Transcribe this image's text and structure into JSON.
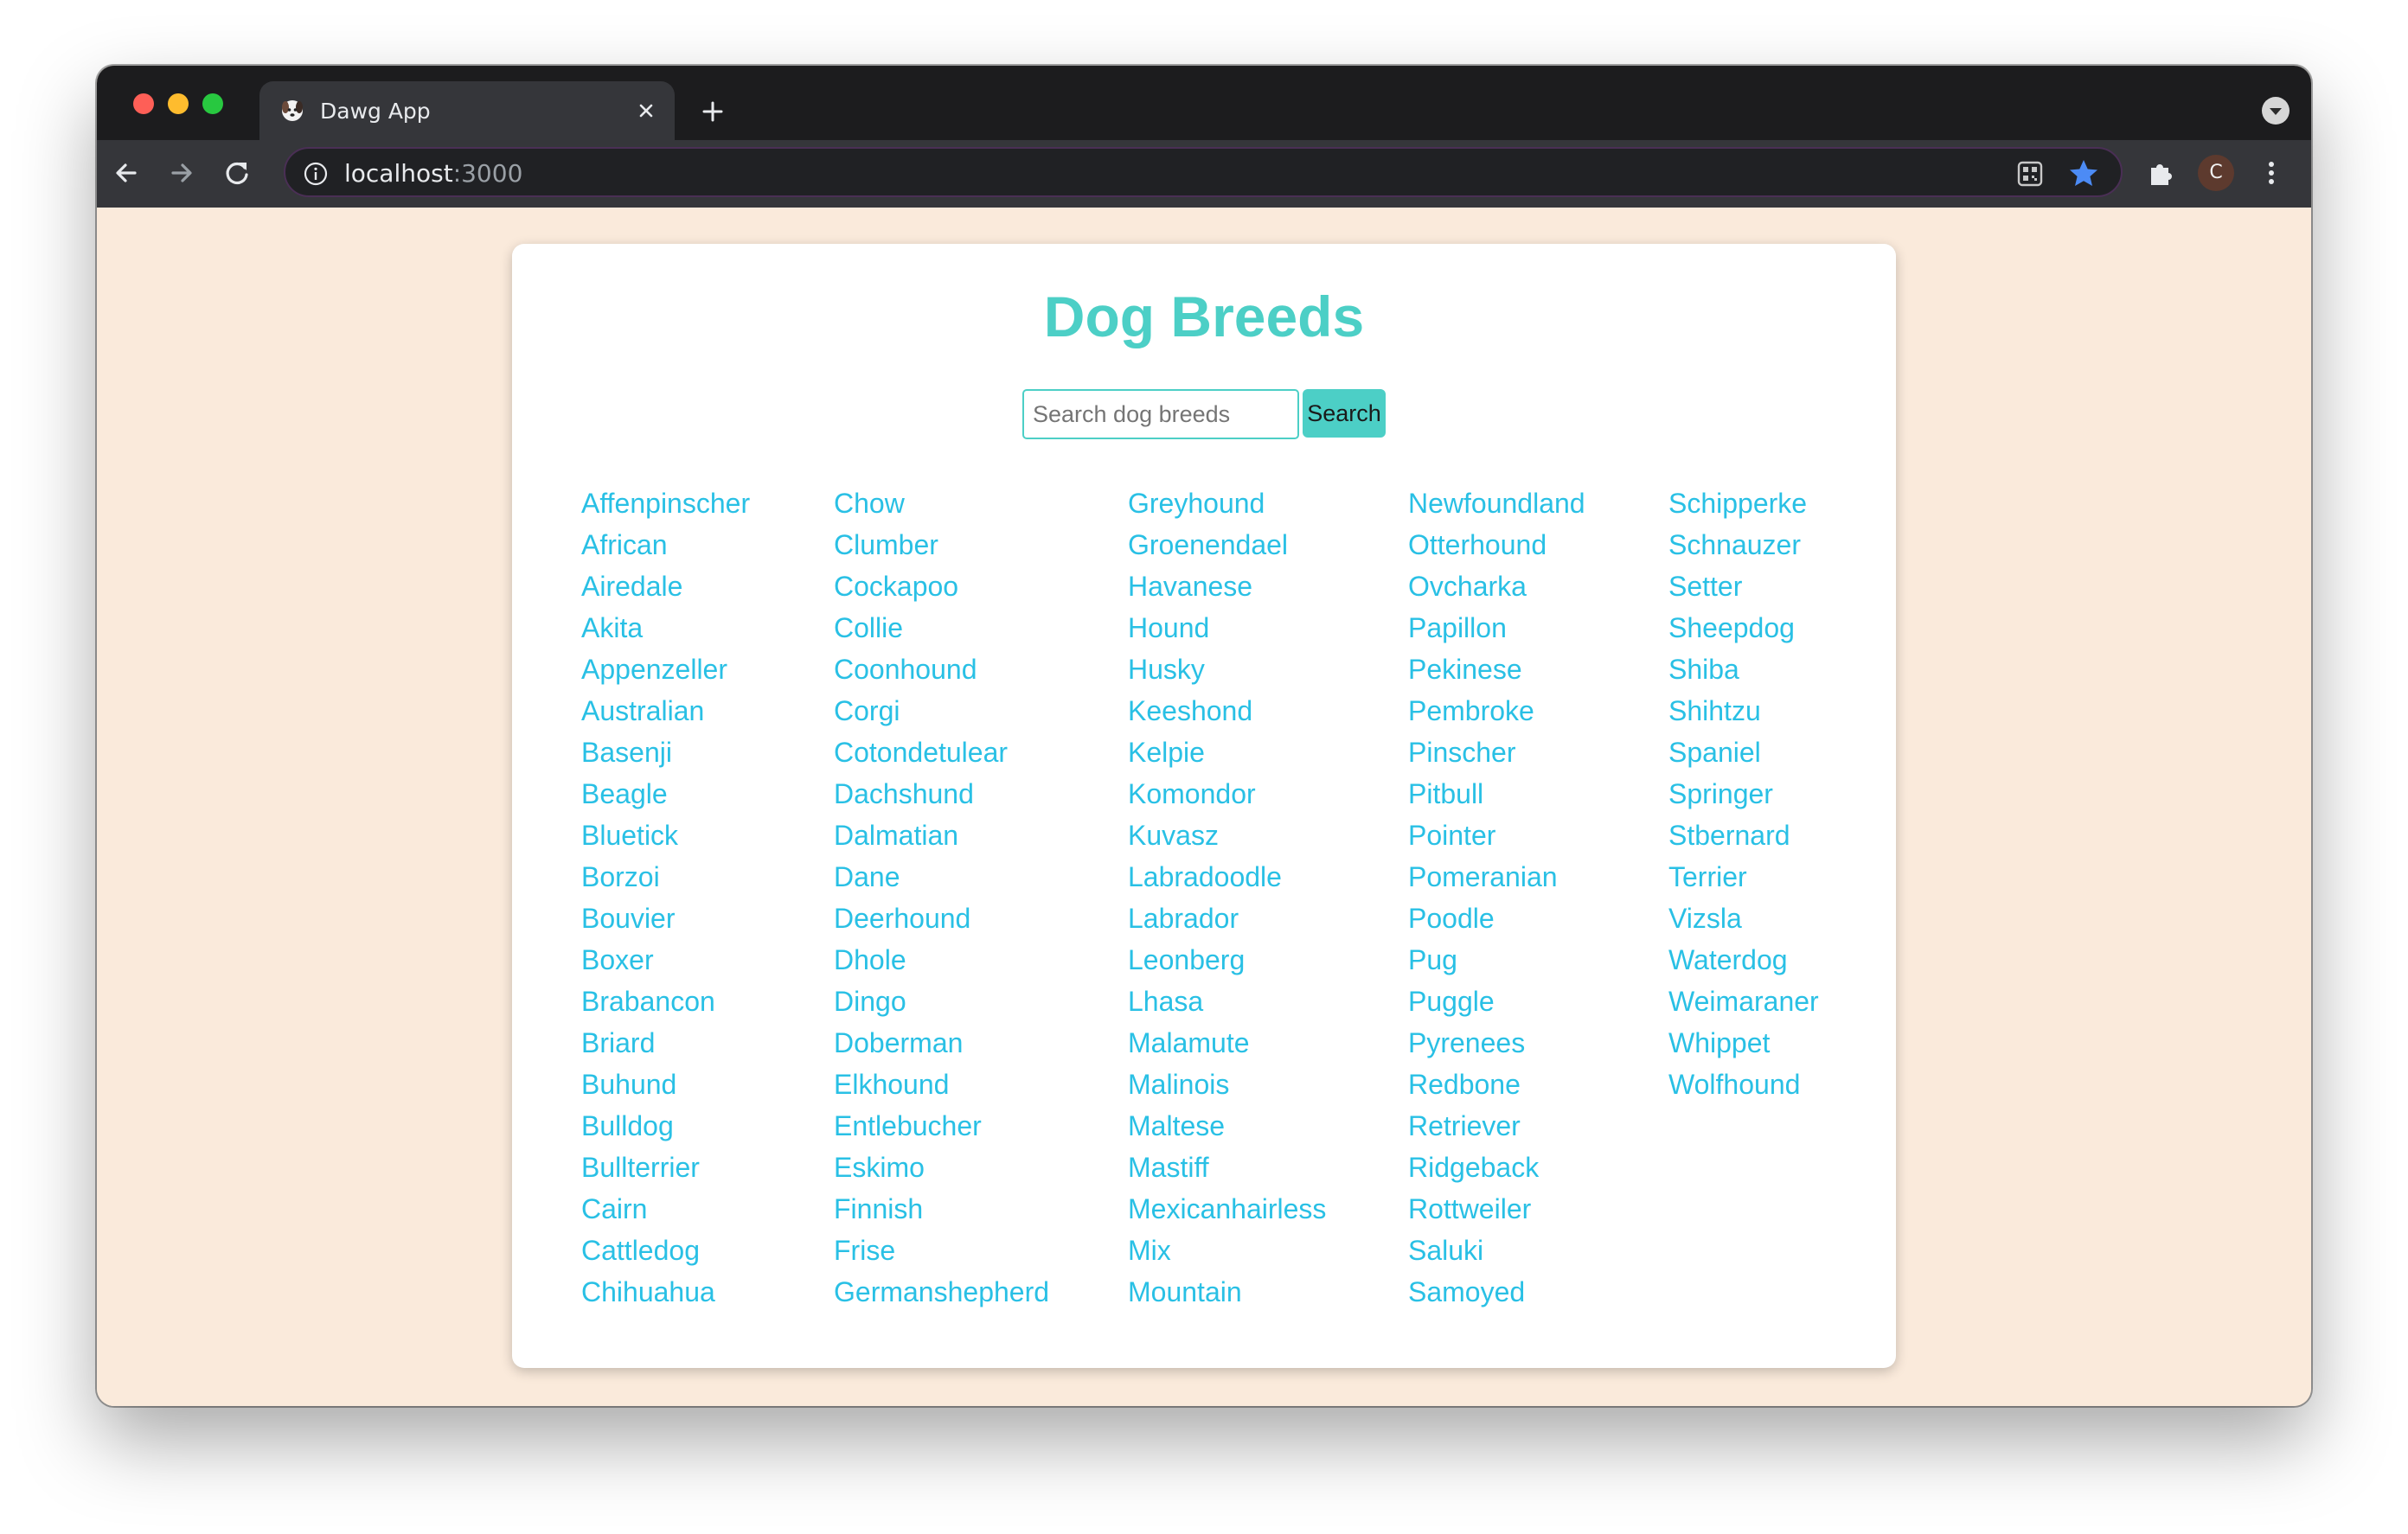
{
  "browser": {
    "tab": {
      "title": "Dawg App"
    },
    "url": {
      "host": "localhost",
      "port": ":3000"
    },
    "profile_initial": "C",
    "icons": {
      "favicon": "dog-face-icon",
      "tab_close": "close-icon",
      "new_tab": "plus-icon",
      "tab_search": "chevron-down-icon",
      "back": "arrow-left-icon",
      "forward": "arrow-right-icon",
      "reload": "reload-icon",
      "site_info": "info-icon",
      "qr": "qr-code-icon",
      "bookmark": "star-icon",
      "extensions": "puzzle-icon",
      "menu": "kebab-menu-icon"
    }
  },
  "page": {
    "title": "Dog Breeds",
    "search": {
      "placeholder": "Search dog breeds",
      "button_label": "Search"
    },
    "breed_columns": [
      [
        "Affenpinscher",
        "African",
        "Airedale",
        "Akita",
        "Appenzeller",
        "Australian",
        "Basenji",
        "Beagle",
        "Bluetick",
        "Borzoi",
        "Bouvier",
        "Boxer",
        "Brabancon",
        "Briard",
        "Buhund",
        "Bulldog",
        "Bullterrier",
        "Cairn",
        "Cattledog",
        "Chihuahua"
      ],
      [
        "Chow",
        "Clumber",
        "Cockapoo",
        "Collie",
        "Coonhound",
        "Corgi",
        "Cotondetulear",
        "Dachshund",
        "Dalmatian",
        "Dane",
        "Deerhound",
        "Dhole",
        "Dingo",
        "Doberman",
        "Elkhound",
        "Entlebucher",
        "Eskimo",
        "Finnish",
        "Frise",
        "Germanshepherd"
      ],
      [
        "Greyhound",
        "Groenendael",
        "Havanese",
        "Hound",
        "Husky",
        "Keeshond",
        "Kelpie",
        "Komondor",
        "Kuvasz",
        "Labradoodle",
        "Labrador",
        "Leonberg",
        "Lhasa",
        "Malamute",
        "Malinois",
        "Maltese",
        "Mastiff",
        "Mexicanhairless",
        "Mix",
        "Mountain"
      ],
      [
        "Newfoundland",
        "Otterhound",
        "Ovcharka",
        "Papillon",
        "Pekinese",
        "Pembroke",
        "Pinscher",
        "Pitbull",
        "Pointer",
        "Pomeranian",
        "Poodle",
        "Pug",
        "Puggle",
        "Pyrenees",
        "Redbone",
        "Retriever",
        "Ridgeback",
        "Rottweiler",
        "Saluki",
        "Samoyed"
      ],
      [
        "Schipperke",
        "Schnauzer",
        "Setter",
        "Sheepdog",
        "Shiba",
        "Shihtzu",
        "Spaniel",
        "Springer",
        "Stbernard",
        "Terrier",
        "Vizsla",
        "Waterdog",
        "Weimaraner",
        "Whippet",
        "Wolfhound"
      ]
    ]
  },
  "colors": {
    "accent": "#4ccfc6",
    "link": "#29c0e5",
    "page_background": "#faeadb",
    "bookmark_star": "#4c8bf5"
  }
}
